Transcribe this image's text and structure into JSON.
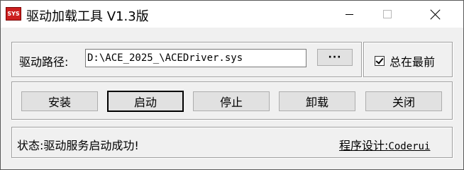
{
  "window": {
    "icon_text": "SYS",
    "title": "驱动加载工具 V1.3版",
    "controls": {
      "minimize_icon": "minimize-icon",
      "maximize_icon": "maximize-icon",
      "close_icon": "close-icon"
    }
  },
  "path_group": {
    "label": "驱动路径:",
    "value": "D:\\ACE_2025_\\ACEDriver.sys",
    "browse_label": "···"
  },
  "topmost": {
    "label": "总在最前",
    "checked": true
  },
  "actions": {
    "install": "安装",
    "start": "启动",
    "stop": "停止",
    "uninstall": "卸载",
    "close": "关闭"
  },
  "status": {
    "text": "状态:驱动服务启动成功!",
    "credit_prefix": "程序设计:",
    "credit_name": "Coderui"
  },
  "colors": {
    "icon_bg": "#cc1f1f",
    "window_bg": "#f0f0f0",
    "titlebar_bg": "#ffffff",
    "button_bg": "#e1e1e1"
  }
}
